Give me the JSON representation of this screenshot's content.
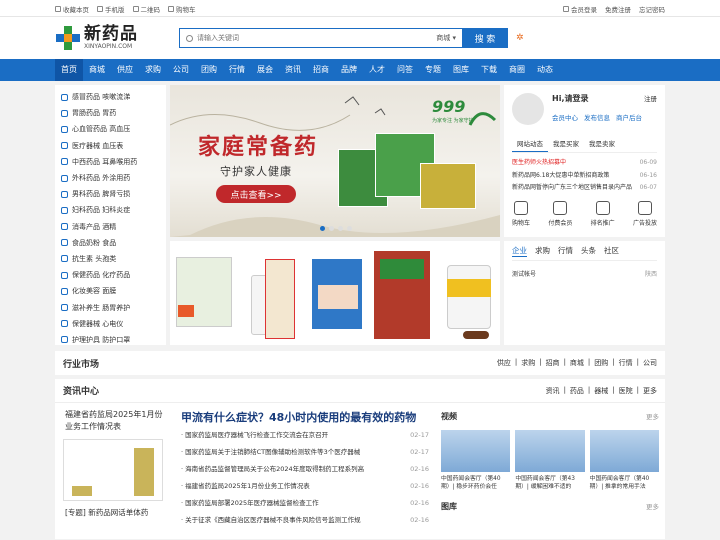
{
  "topbar": {
    "left": [
      "收藏本页",
      "手机版",
      "二维码",
      "购物车"
    ],
    "right": [
      "会员登录",
      "免费注册",
      "忘记密码"
    ]
  },
  "logo": {
    "cn": "新药品",
    "en": "XINYAOPIN.COM"
  },
  "search": {
    "placeholder": "请输入关键词",
    "scope": "商城",
    "button": "搜 索"
  },
  "nav": [
    "首页",
    "商城",
    "供应",
    "求购",
    "公司",
    "团购",
    "行情",
    "展会",
    "资讯",
    "招商",
    "品牌",
    "人才",
    "问答",
    "专题",
    "图库",
    "下载",
    "商圈",
    "动态"
  ],
  "categories": [
    "感冒药品 咳嗽流涕",
    "胃肠药品 胃药",
    "心血管药品 高血压",
    "医疗器械 血压表",
    "中西药品 耳鼻喉用药",
    "外科药品 外涂用药",
    "男科药品 脾肾亏损",
    "妇科药品 妇科炎症",
    "消毒产品 酒精",
    "食品奶粉 食品",
    "抗生素 头孢类",
    "保健药品 化疗药品",
    "化妆美容 面膜",
    "滋补养生 肠胃养护",
    "保健器械 心电仪",
    "护理护具 防护口罩"
  ],
  "banner": {
    "title": "家庭常备药",
    "subtitle": "守护家人健康",
    "cta": "点击查看>>",
    "brand": "999",
    "brand_sub": "为家专注  为家守护"
  },
  "login": {
    "greeting": "Hi,请登录",
    "register": "注册",
    "links": [
      "会员中心",
      "发布信息",
      "商户后台"
    ],
    "tabs": [
      "网站动态",
      "我是买家",
      "我是卖家"
    ],
    "news": [
      {
        "t": "医生药师火热招募中",
        "d": "06-09",
        "red": true
      },
      {
        "t": "新药品网6.18大促惠中单新招商政策",
        "d": "06-16",
        "red": false
      },
      {
        "t": "新药品网暂停向广东三个地区销售目录内产品",
        "d": "06-07",
        "red": false
      }
    ],
    "icons": [
      "购物车",
      "付费会员",
      "排名推广",
      "广告投放"
    ]
  },
  "company": {
    "tabs": [
      "企业",
      "求购",
      "行情",
      "头条",
      "社区"
    ],
    "rows": [
      {
        "t": "测试帐号",
        "d": "陕西"
      }
    ]
  },
  "market": {
    "title": "行业市场",
    "links": [
      "供应",
      "求购",
      "招商",
      "商城",
      "团购",
      "行情",
      "公司"
    ]
  },
  "newsCenter": {
    "title": "资讯中心",
    "links": [
      "资讯",
      "药品",
      "器械",
      "医院",
      "更多"
    ],
    "stat_title": "福建省药监局2025年1月份业务工作情况表",
    "stat_foot": "[专题] 新药品网话单体药",
    "headline": "甲流有什么症状？48小时内使用的最有效的药物",
    "items": [
      {
        "t": "国家药监局医疗器械飞行检查工作交流会在京召开",
        "d": "02-17"
      },
      {
        "t": "国家药监局关于注销肺结CT图像辅助检测软件等3个医疗器械",
        "d": "02-17"
      },
      {
        "t": "海南省药品监督管理局关于公布2024年度取得制药工程系列高",
        "d": "02-16"
      },
      {
        "t": "福建省药监局2025年1月份业务工作情况表",
        "d": "02-16"
      },
      {
        "t": "国家药监局部署2025年医疗器械监督检查工作",
        "d": "02-16"
      },
      {
        "t": "关于征求《西藏自治区医疗器械不良事件风险信号监测工作规",
        "d": "02-16"
      }
    ],
    "video_title": "视频",
    "video_more": "更多",
    "videos": [
      "中国药闻会客厅（第40期）| 稳步环药价会任",
      "中国药闻会客厅（第43期）| 缓解困难不适的",
      "中国药闻会客厅（第40期）| 推拿的常用手法"
    ],
    "gallery_title": "图库",
    "gallery_more": "更多"
  }
}
